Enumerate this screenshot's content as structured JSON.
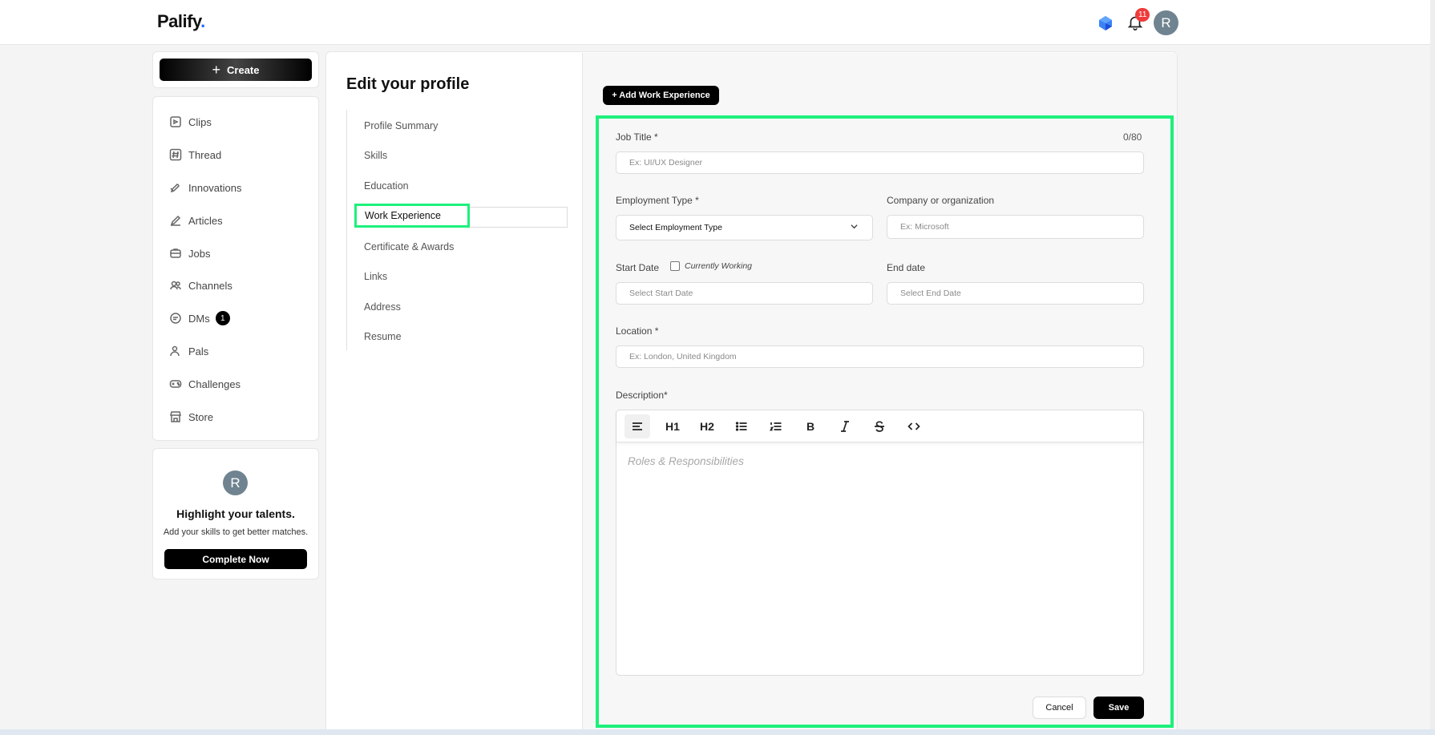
{
  "app": {
    "logo_text": "Palify",
    "logo_dot": "."
  },
  "topbar": {
    "notifications_count": "11",
    "avatar_initial": "R"
  },
  "sidebar": {
    "create_label": "Create",
    "nav": [
      {
        "label": "Clips",
        "icon": "clips-icon"
      },
      {
        "label": "Thread",
        "icon": "hash-icon"
      },
      {
        "label": "Innovations",
        "icon": "rocket-icon"
      },
      {
        "label": "Articles",
        "icon": "pencil-icon"
      },
      {
        "label": "Jobs",
        "icon": "briefcase-icon"
      },
      {
        "label": "Channels",
        "icon": "users-icon"
      },
      {
        "label": "DMs",
        "icon": "chat-icon",
        "badge": "1"
      },
      {
        "label": "Pals",
        "icon": "pals-icon"
      },
      {
        "label": "Challenges",
        "icon": "gamepad-icon"
      },
      {
        "label": "Store",
        "icon": "store-icon"
      }
    ],
    "promo": {
      "avatar_initial": "R",
      "title": "Highlight your talents.",
      "subtitle": "Add your skills to get better matches.",
      "button_label": "Complete Now"
    }
  },
  "profile": {
    "title": "Edit your profile",
    "sections": [
      "Profile Summary",
      "Skills",
      "Education",
      "Work Experience",
      "Certificate & Awards",
      "Links",
      "Address",
      "Resume"
    ],
    "active_section": "Work Experience"
  },
  "form": {
    "add_button": "+ Add Work Experience",
    "job_title": {
      "label": "Job Title *",
      "counter": "0/80",
      "placeholder": "Ex: UI/UX Designer"
    },
    "employment_type": {
      "label": "Employment Type *",
      "selected": "Select Employment Type"
    },
    "company": {
      "label": "Company or organization",
      "placeholder": "Ex: Microsoft"
    },
    "start_date": {
      "label": "Start Date",
      "placeholder": "Select Start Date"
    },
    "currently_working": "Currently Working",
    "end_date": {
      "label": "End date",
      "placeholder": "Select End Date"
    },
    "location": {
      "label": "Location *",
      "placeholder": "Ex: London, United Kingdom"
    },
    "description": {
      "label": "Description*",
      "placeholder": "Roles & Responsibilities",
      "toolbar": {
        "h1": "H1",
        "h2": "H2",
        "bold": "B"
      }
    },
    "cancel_label": "Cancel",
    "save_label": "Save"
  },
  "colors": {
    "highlight": "#1df07b",
    "badge": "#ef3b3b",
    "avatar": "#6f8390"
  }
}
